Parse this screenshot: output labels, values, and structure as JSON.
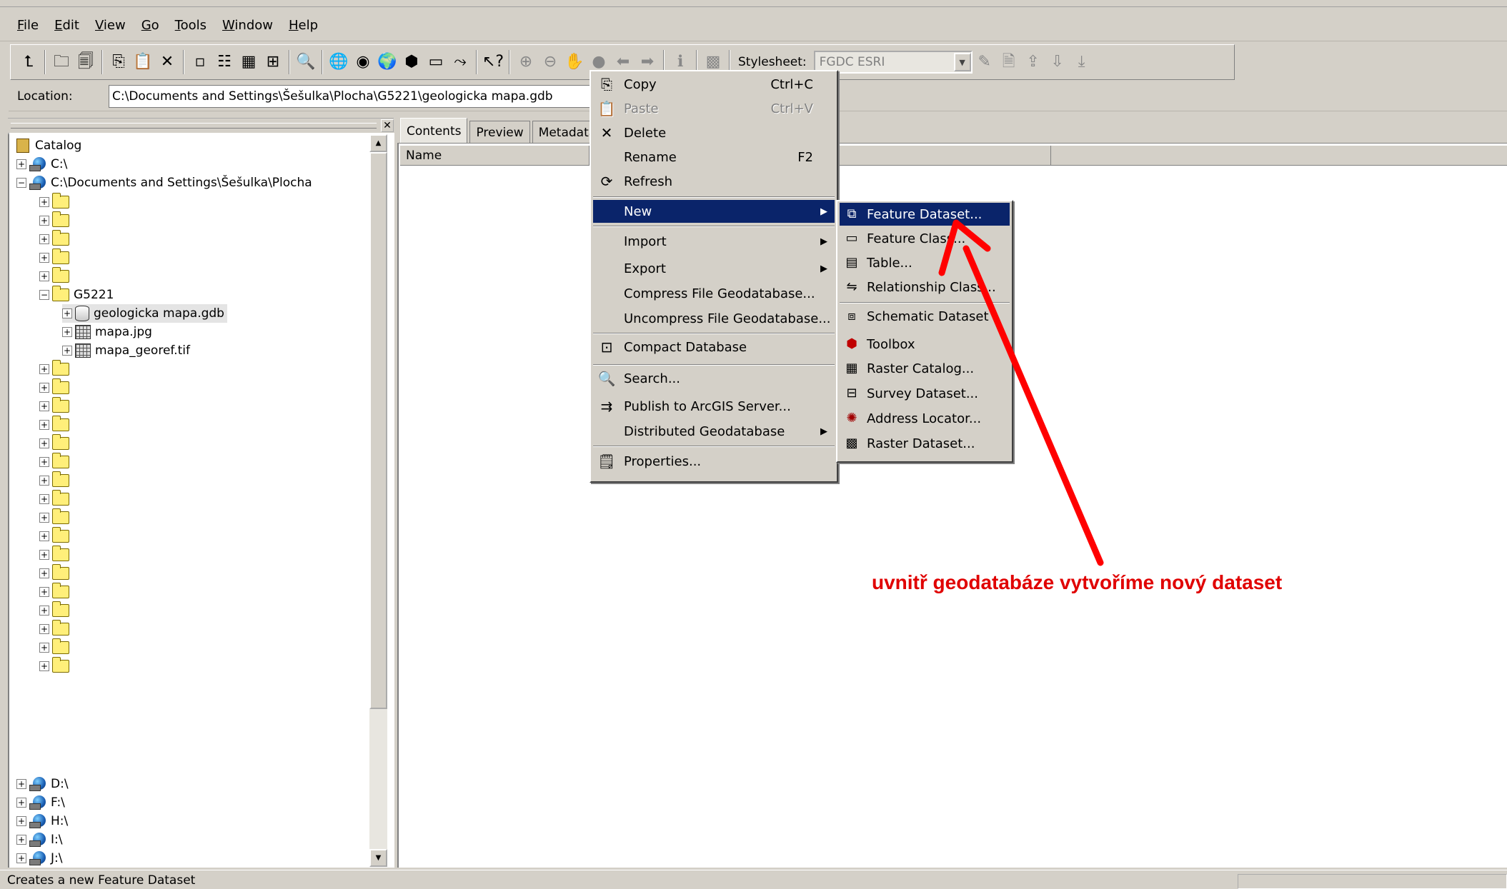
{
  "menubar": [
    "File",
    "Edit",
    "View",
    "Go",
    "Tools",
    "Window",
    "Help"
  ],
  "toolbar": {
    "stylesheet_label": "Stylesheet:",
    "stylesheet_value": "FGDC ESRI"
  },
  "location": {
    "label": "Location:",
    "value": "C:\\Documents and Settings\\Šešulka\\Plocha\\G5221\\geologicka mapa.gdb"
  },
  "tree": {
    "catalog": "Catalog",
    "c_drive": "C:\\",
    "desktop": "C:\\Documents and Settings\\Šešulka\\Plocha",
    "g5221": "G5221",
    "gdb": "geologicka mapa.gdb",
    "jpg": "mapa.jpg",
    "tif": "mapa_georef.tif",
    "d_drive": "D:\\",
    "f_drive": "F:\\",
    "h_drive": "H:\\",
    "i_drive": "I:\\",
    "j_drive": "J:\\"
  },
  "tabs": [
    "Contents",
    "Preview",
    "Metadata"
  ],
  "columns": {
    "name": "Name"
  },
  "context_menu": {
    "copy": "Copy",
    "copy_sc": "Ctrl+C",
    "paste": "Paste",
    "paste_sc": "Ctrl+V",
    "delete": "Delete",
    "rename": "Rename",
    "rename_sc": "F2",
    "refresh": "Refresh",
    "new": "New",
    "import": "Import",
    "export": "Export",
    "compress": "Compress File Geodatabase...",
    "uncompress": "Uncompress File Geodatabase...",
    "compact": "Compact Database",
    "search": "Search...",
    "publish": "Publish to ArcGIS Server...",
    "distributed": "Distributed Geodatabase",
    "properties": "Properties..."
  },
  "submenu": {
    "feature_dataset": "Feature Dataset...",
    "feature_class": "Feature Class...",
    "table": "Table...",
    "relationship_class": "Relationship Class...",
    "schematic_dataset": "Schematic Dataset",
    "toolbox": "Toolbox",
    "raster_catalog": "Raster Catalog...",
    "survey_dataset": "Survey Dataset...",
    "address_locator": "Address Locator...",
    "raster_dataset": "Raster Dataset..."
  },
  "annotation": "uvnitř geodatabáze vytvoříme nový dataset",
  "status": "Creates a new Feature Dataset",
  "colors": {
    "chrome": "#d4d0c8",
    "highlight": "#0a246a",
    "annotation": "#e00000"
  }
}
